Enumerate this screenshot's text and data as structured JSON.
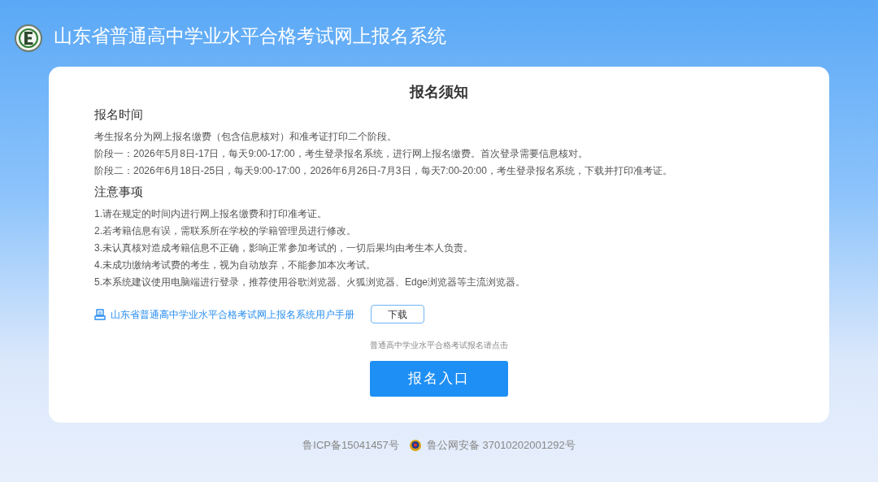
{
  "header": {
    "title": "山东省普通高中学业水平合格考试网上报名系统"
  },
  "notice": {
    "title": "报名须知",
    "sections": [
      {
        "heading": "报名时间",
        "lines": [
          "考生报名分为网上报名缴费（包含信息核对）和准考证打印二个阶段。",
          "阶段一：2026年5月8日-17日，每天9:00-17:00，考生登录报名系统，进行网上报名缴费。首次登录需要信息核对。",
          "阶段二：2026年6月18日-25日，每天9:00-17:00，2026年6月26日-7月3日，每天7:00-20:00，考生登录报名系统，下载并打印准考证。"
        ]
      },
      {
        "heading": "注意事项",
        "lines": [
          "1.请在规定的时间内进行网上报名缴费和打印准考证。",
          "2.若考籍信息有误，需联系所在学校的学籍管理员进行修改。",
          "3.未认真核对造成考籍信息不正确，影响正常参加考试的，一切后果均由考生本人负责。",
          "4.未成功缴纳考试费的考生，视为自动放弃，不能参加本次考试。",
          "5.本系统建议使用电脑端进行登录，推荐使用谷歌浏览器、火狐浏览器、Edge浏览器等主流浏览器。"
        ]
      }
    ],
    "manual": {
      "link": "山东省普通高中学业水平合格考试网上报名系统用户手册",
      "button": "下载"
    },
    "entry": {
      "hint": "普通高中学业水平合格考试报名请点击",
      "button": "报名入口"
    }
  },
  "footer": {
    "icp": "鲁ICP备15041457号",
    "police": "鲁公网安备 37010202001292号"
  }
}
